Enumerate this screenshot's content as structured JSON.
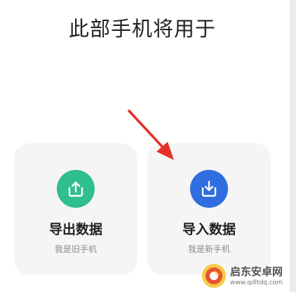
{
  "page": {
    "title": "此部手机将用于"
  },
  "options": [
    {
      "label": "导出数据",
      "sublabel": "我是旧手机",
      "icon": "upload-tray-icon",
      "color": "#2fbe8f"
    },
    {
      "label": "导入数据",
      "sublabel": "我是新手机",
      "icon": "download-tray-icon",
      "color": "#2f6de0"
    }
  ],
  "annotation": {
    "icon": "red-arrow-icon",
    "color": "#e8302a"
  },
  "watermark": {
    "name": "启东安卓网",
    "url": "www.qdltdq.com",
    "icon": "site-logo-icon"
  }
}
